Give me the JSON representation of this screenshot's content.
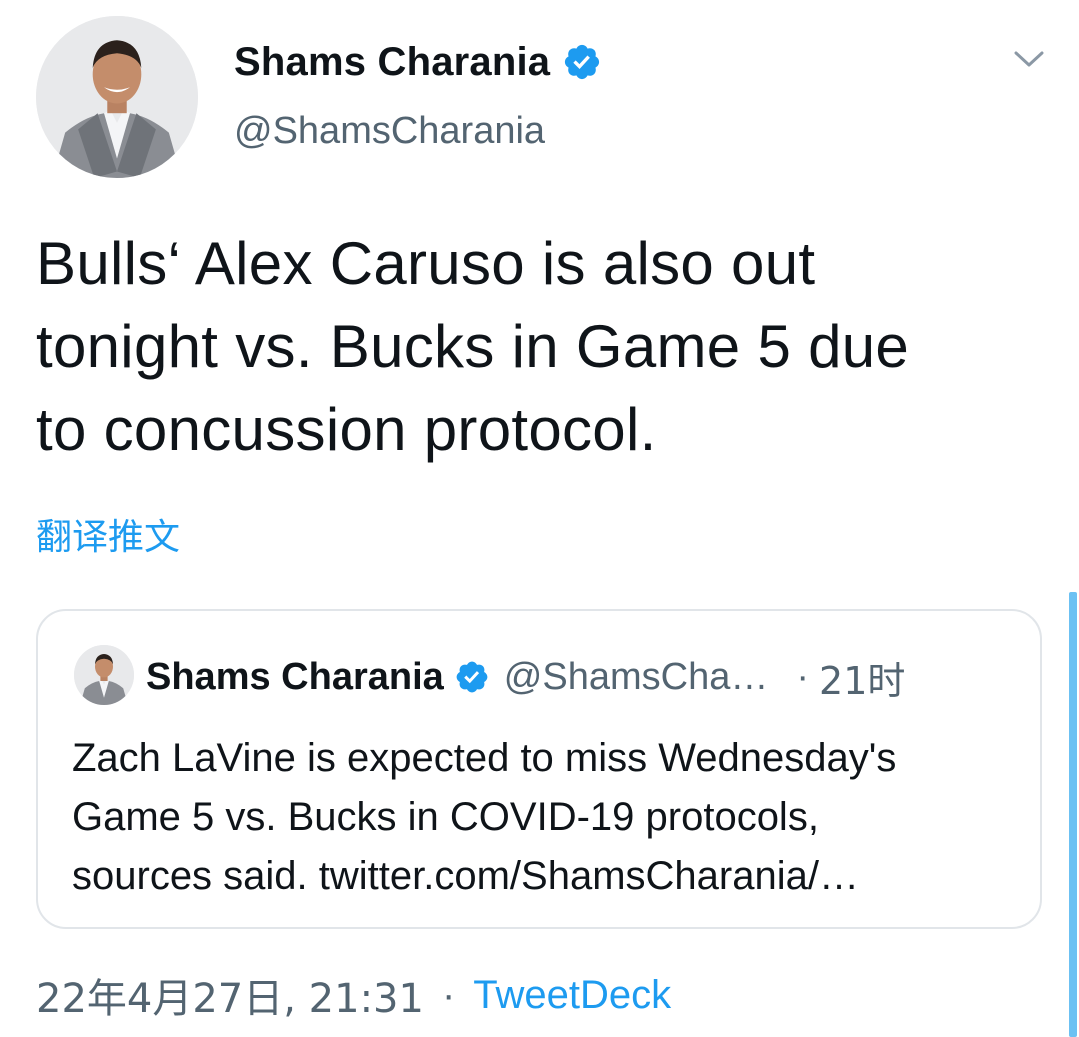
{
  "tweet": {
    "author": {
      "display_name": "Shams Charania",
      "handle": "@ShamsCharania",
      "verified": true,
      "avatar": "profile-photo"
    },
    "text_lines": [
      "Bulls‘ Alex Caruso is also out",
      "tonight vs. Bucks in Game 5 due",
      "to concussion protocol."
    ],
    "translate_label": "翻译推文",
    "menu_icon": "chevron-down-icon"
  },
  "quoted_tweet": {
    "display_name": "Shams Charania",
    "handle": "@ShamsCha…",
    "separator": "·",
    "time": "21时",
    "verified": true,
    "text_lines": [
      "Zach LaVine is expected to miss Wednesday's",
      "Game 5 vs. Bucks in COVID-19 protocols,",
      "sources said. twitter.com/ShamsCharania/…"
    ]
  },
  "meta": {
    "date": "22年4月27日, 21:31",
    "separator": "·",
    "source": "TweetDeck"
  },
  "colors": {
    "accent": "#1d9bf0",
    "text_primary": "#0f1419",
    "text_secondary": "#536471",
    "border": "#e1e5e9",
    "scrollbar": "#6cc1f3"
  }
}
